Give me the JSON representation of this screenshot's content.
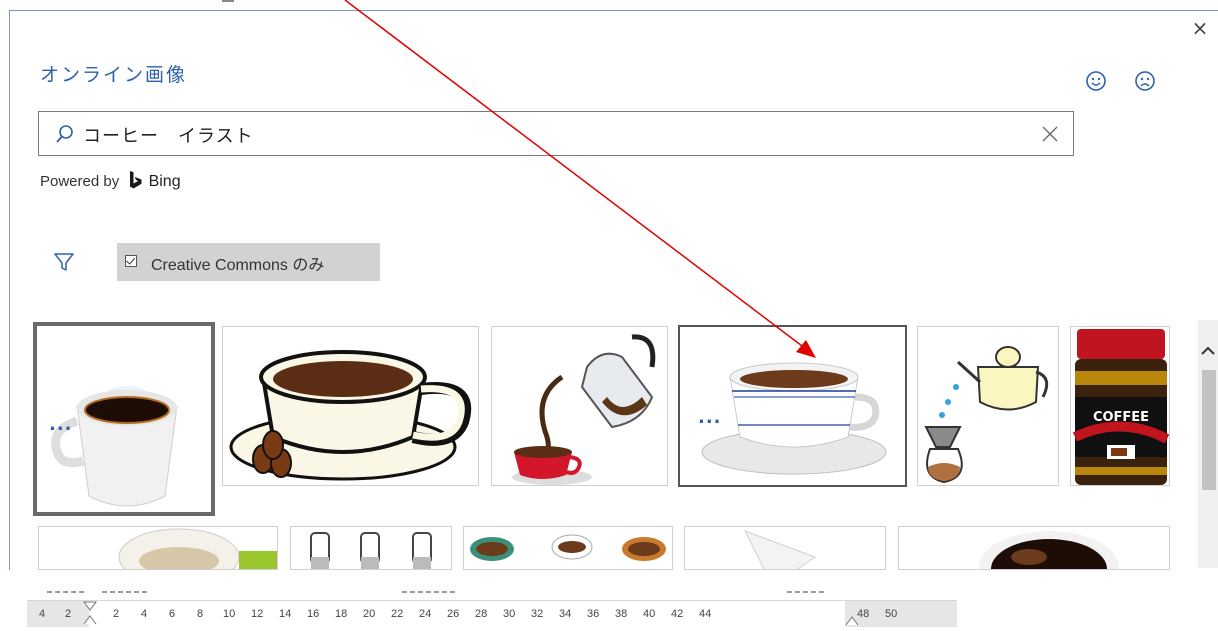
{
  "dialog": {
    "title": "オンライン画像",
    "close_symbol": "×",
    "feedback": {
      "smile_icon": "smile-icon",
      "frown_icon": "frown-icon"
    }
  },
  "search": {
    "value": "コーヒー　イラスト",
    "search_icon": "search-icon",
    "clear_icon": "clear-icon"
  },
  "powered": {
    "text": "Powered by",
    "brand": "Bing"
  },
  "filter": {
    "filter_icon": "filter-icon",
    "creative_commons_label": "Creative Commons のみ",
    "creative_commons_checked": true
  },
  "results": {
    "more_symbol": "...",
    "items": [
      {
        "name": "coffee-cup-white-glossy"
      },
      {
        "name": "coffee-cup-beans"
      },
      {
        "name": "coffee-pot-pouring"
      },
      {
        "name": "coffee-cup-saucer-blue"
      },
      {
        "name": "kettle-drip"
      },
      {
        "name": "instant-coffee-jar",
        "label": "COFFEE"
      },
      {
        "name": "coffee-mug-green"
      },
      {
        "name": "bottles-row"
      },
      {
        "name": "cups-row"
      },
      {
        "name": "paper-filter"
      },
      {
        "name": "coffee-top-view"
      }
    ]
  },
  "ruler": {
    "numbers": [
      "4",
      "2",
      "2",
      "4",
      "6",
      "8",
      "10",
      "12",
      "14",
      "16",
      "18",
      "20",
      "22",
      "24",
      "26",
      "28",
      "30",
      "32",
      "34",
      "36",
      "38",
      "40",
      "42",
      "44",
      "48",
      "50"
    ]
  },
  "colors": {
    "accent": "#2e62a8",
    "annotation_arrow": "#e00000"
  }
}
